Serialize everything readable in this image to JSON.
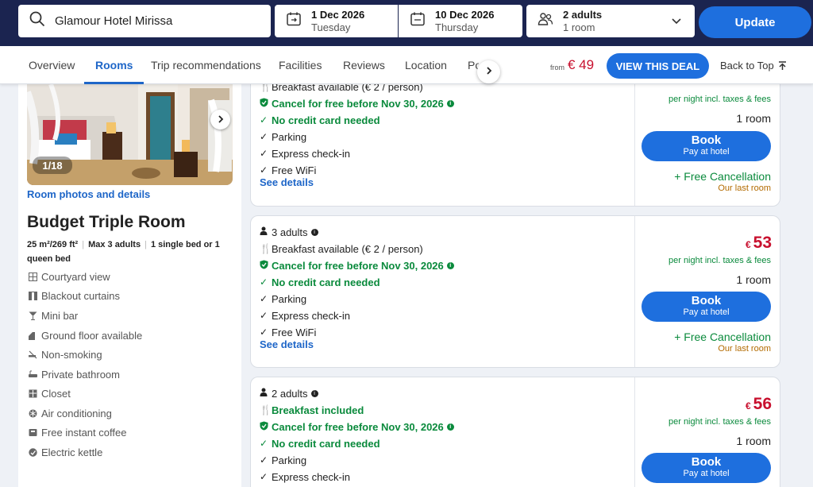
{
  "search": {
    "hotel": "Glamour Hotel Mirissa",
    "checkin_date": "1 Dec 2026",
    "checkin_day": "Tuesday",
    "checkout_date": "10 Dec 2026",
    "checkout_day": "Thursday",
    "guests": "2 adults",
    "rooms": "1 room",
    "update_label": "Update"
  },
  "tabs": [
    {
      "label": "Overview"
    },
    {
      "label": "Rooms"
    },
    {
      "label": "Trip recommendations"
    },
    {
      "label": "Facilities"
    },
    {
      "label": "Reviews"
    },
    {
      "label": "Location"
    },
    {
      "label": "Po"
    }
  ],
  "deal": {
    "from_label": "from",
    "price": "€ 49",
    "view_label": "VIEW THIS DEAL",
    "back_to_top": "Back to Top"
  },
  "room": {
    "photo_count": "1/18",
    "photo_link": "Room photos and details",
    "title": "Budget Triple Room",
    "size": "25 m²/269 ft²",
    "max": "Max 3 adults",
    "bed": "1 single bed or 1 queen bed",
    "amenities": [
      {
        "icon": "window-icon",
        "label": "Courtyard view"
      },
      {
        "icon": "curtains-icon",
        "label": "Blackout curtains"
      },
      {
        "icon": "cocktail-icon",
        "label": "Mini bar"
      },
      {
        "icon": "floor-icon",
        "label": "Ground floor available"
      },
      {
        "icon": "no-smoking-icon",
        "label": "Non-smoking"
      },
      {
        "icon": "bathtub-icon",
        "label": "Private bathroom"
      },
      {
        "icon": "closet-icon",
        "label": "Closet"
      },
      {
        "icon": "snowflake-icon",
        "label": "Air conditioning"
      },
      {
        "icon": "coffee-icon",
        "label": "Free instant coffee"
      },
      {
        "icon": "kettle-icon",
        "label": "Electric kettle"
      }
    ]
  },
  "offers": [
    {
      "breakfast": "Breakfast available (€ 2 / person)",
      "cancel": "Cancel for free before Nov 30, 2026",
      "no_cc": "No credit card needed",
      "parking": "Parking",
      "checkin": "Express check-in",
      "wifi": "Free WiFi",
      "see_details": "See details",
      "per_night": "per night incl. taxes & fees",
      "rooms": "1 room",
      "book": "Book",
      "pay": "Pay at hotel",
      "free_cancel": "+ Free Cancellation",
      "last_room": "Our last room"
    },
    {
      "adults": "3 adults",
      "breakfast": "Breakfast available (€ 2 / person)",
      "cancel": "Cancel for free before Nov 30, 2026",
      "no_cc": "No credit card needed",
      "parking": "Parking",
      "checkin": "Express check-in",
      "wifi": "Free WiFi",
      "see_details": "See details",
      "currency": "€",
      "price": "53",
      "per_night": "per night incl. taxes & fees",
      "rooms": "1 room",
      "book": "Book",
      "pay": "Pay at hotel",
      "free_cancel": "+ Free Cancellation",
      "last_room": "Our last room"
    },
    {
      "adults": "2 adults",
      "breakfast": "Breakfast included",
      "cancel": "Cancel for free before Nov 30, 2026",
      "no_cc": "No credit card needed",
      "parking": "Parking",
      "checkin": "Express check-in",
      "currency": "€",
      "price": "56",
      "per_night": "per night incl. taxes & fees",
      "rooms": "1 room",
      "book": "Book",
      "pay": "Pay at hotel"
    }
  ],
  "colors": {
    "navy": "#1b2450",
    "accent": "#1e6fde",
    "price_red": "#c8102e",
    "green": "#0a8a3c"
  }
}
